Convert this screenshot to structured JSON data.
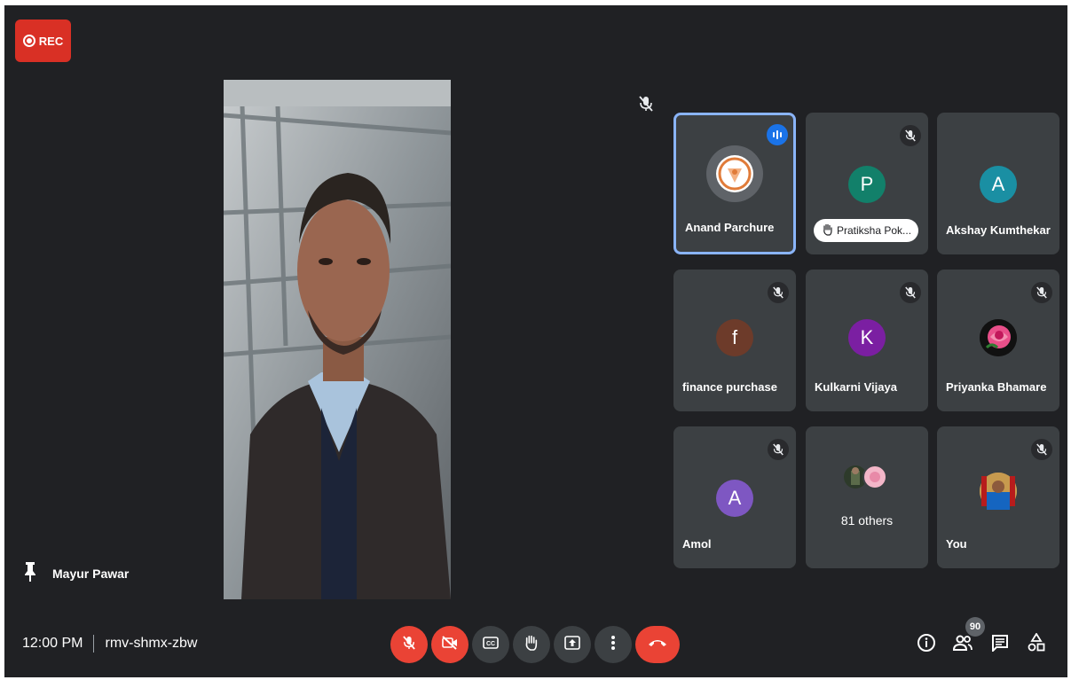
{
  "recording": {
    "label": "REC"
  },
  "main_video": {
    "speaker_name": "Mayur Pawar"
  },
  "participants": [
    {
      "name": "Anand Parchure",
      "avatar_type": "logo",
      "active_speaker": true
    },
    {
      "name": "Pratiksha Pok...",
      "initial": "P",
      "color": "#12806a",
      "hand_raised": true
    },
    {
      "name": "Akshay Kumthekar",
      "initial": "A",
      "color": "#1a8fa3"
    },
    {
      "name": "finance purchase",
      "initial": "f",
      "color": "#6d3b2a"
    },
    {
      "name": "Kulkarni Vijaya",
      "initial": "K",
      "color": "#7b1fa2"
    },
    {
      "name": "Priyanka Bhamare",
      "avatar_type": "photo-rose"
    },
    {
      "name": "Amol",
      "initial": "A",
      "color": "#7e57c2"
    },
    {
      "name": "81 others",
      "avatar_type": "group"
    },
    {
      "name": "You",
      "avatar_type": "photo"
    }
  ],
  "footer": {
    "time": "12:00 PM",
    "meeting_code": "rmv-shmx-zbw",
    "participant_count": "90"
  },
  "controls": [
    {
      "icon": "mic-off-icon",
      "color": "#ea4335"
    },
    {
      "icon": "camera-off-icon",
      "color": "#ea4335"
    },
    {
      "icon": "captions-icon",
      "color": "#3c4043"
    },
    {
      "icon": "raise-hand-icon",
      "color": "#3c4043"
    },
    {
      "icon": "present-icon",
      "color": "#3c4043"
    },
    {
      "icon": "more-options-icon",
      "color": "#3c4043"
    },
    {
      "icon": "leave-call-icon",
      "color": "#ea4335"
    }
  ],
  "side_controls": [
    "info-icon",
    "people-icon",
    "chat-icon",
    "activities-icon"
  ]
}
